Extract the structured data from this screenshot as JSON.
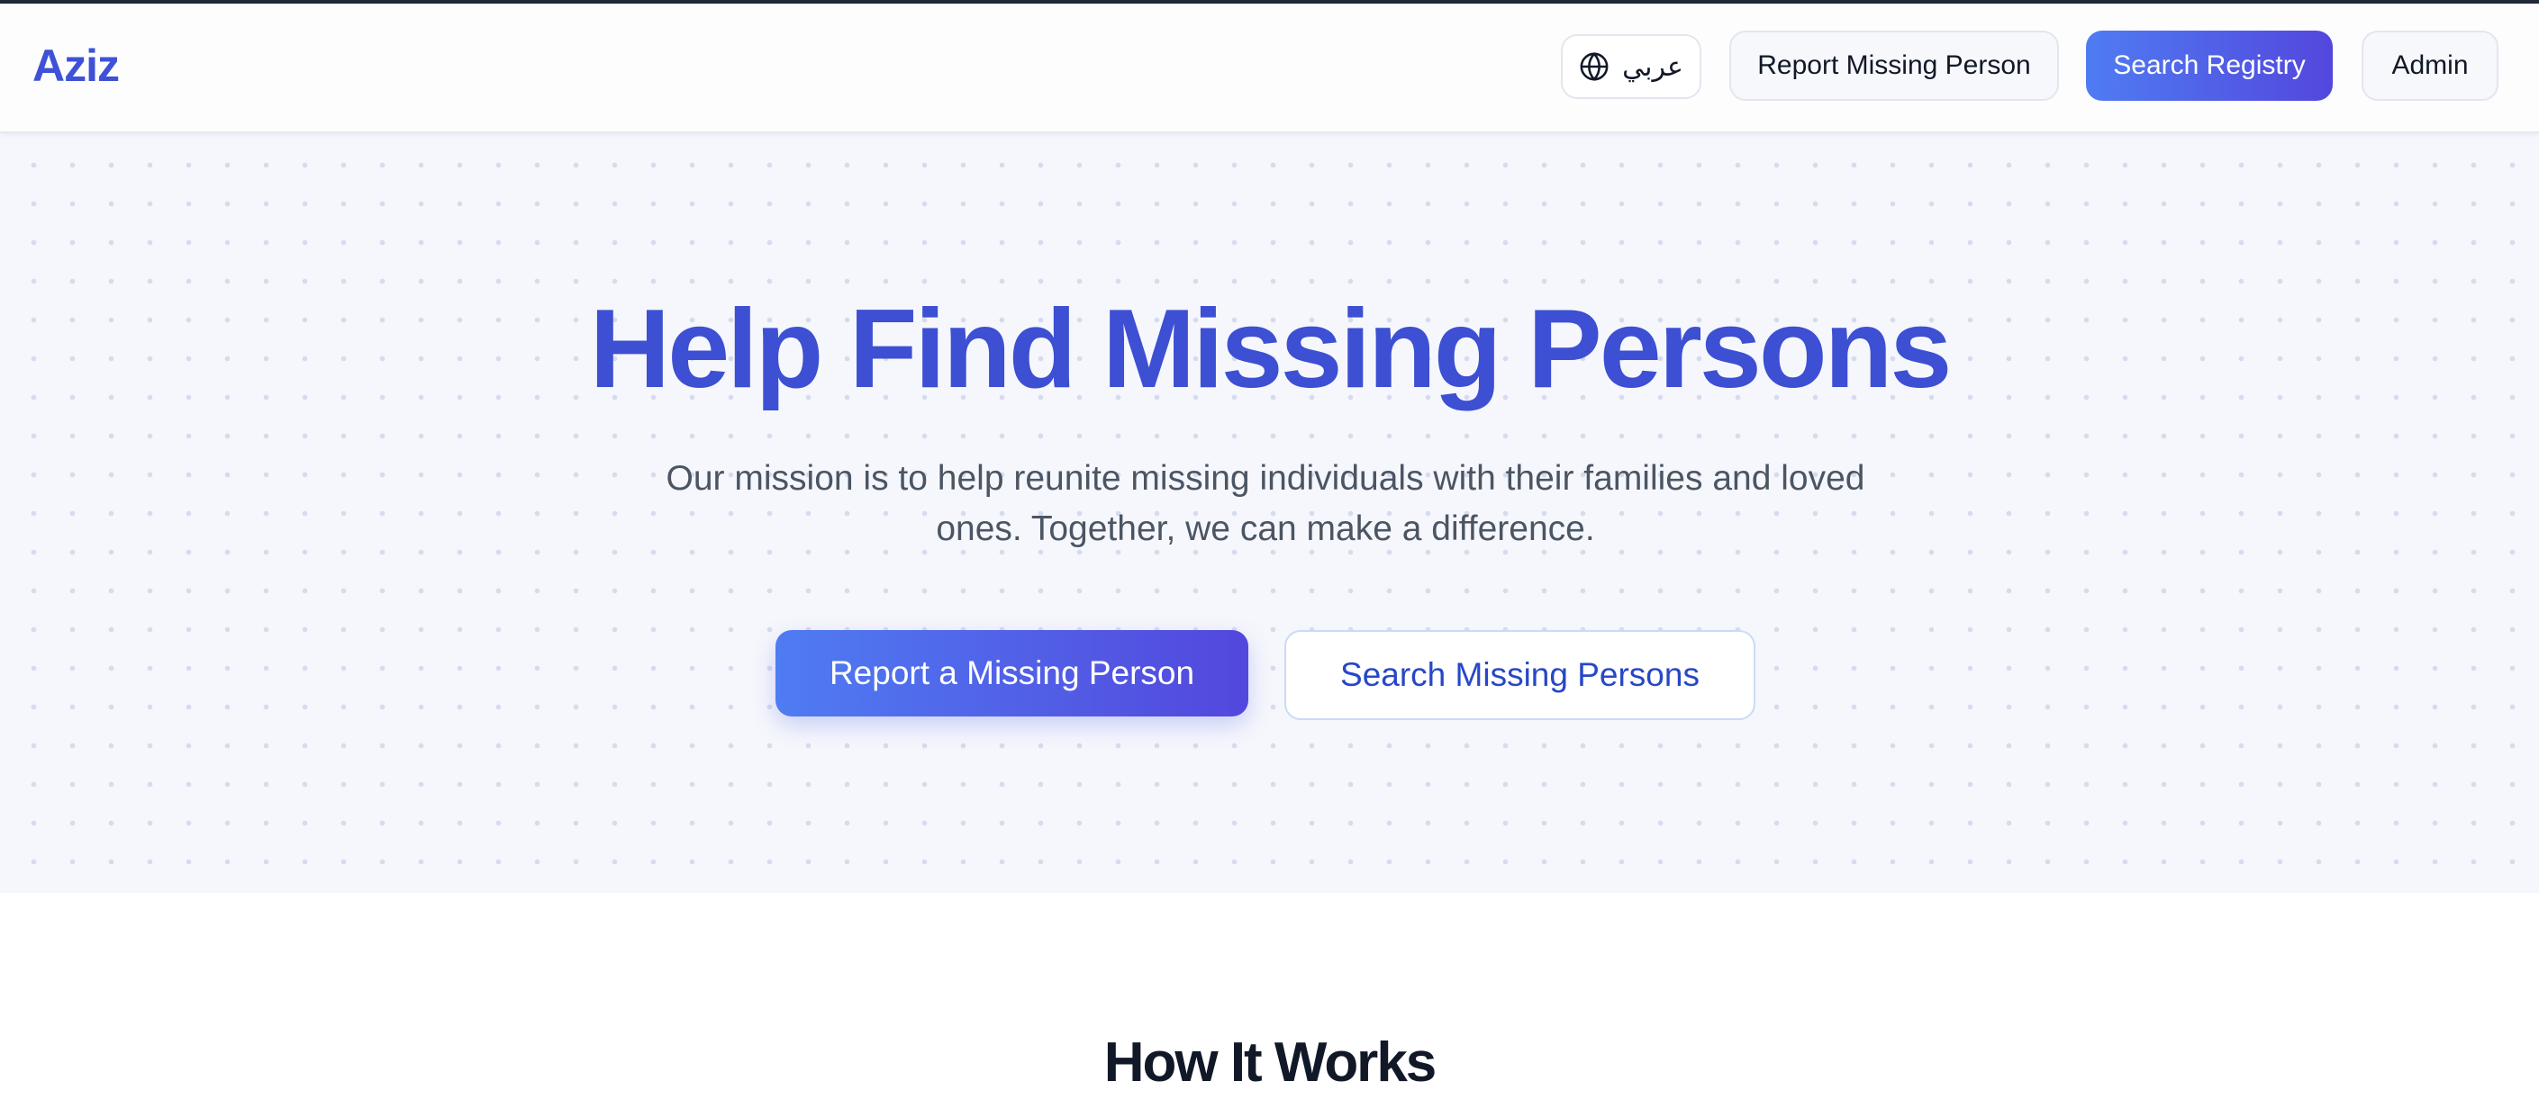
{
  "header": {
    "logo": "Aziz",
    "language_button": {
      "label": "عربي",
      "icon": "globe-icon"
    },
    "report_button": "Report Missing Person",
    "search_button": "Search Registry",
    "admin_button": "Admin"
  },
  "hero": {
    "title": "Help Find Missing Persons",
    "subtitle": "Our mission is to help reunite missing individuals with their families and loved ones. Together, we can make a difference.",
    "primary_button": "Report a Missing Person",
    "secondary_button": "Search Missing Persons"
  },
  "how_it_works": {
    "title": "How It Works"
  },
  "colors": {
    "brand": "#3f51d6",
    "gradient_start": "#4f7cf2",
    "gradient_end": "#5347dd",
    "hero_background": "#f6f7fc",
    "secondary_button_border": "#c9dbf7"
  }
}
